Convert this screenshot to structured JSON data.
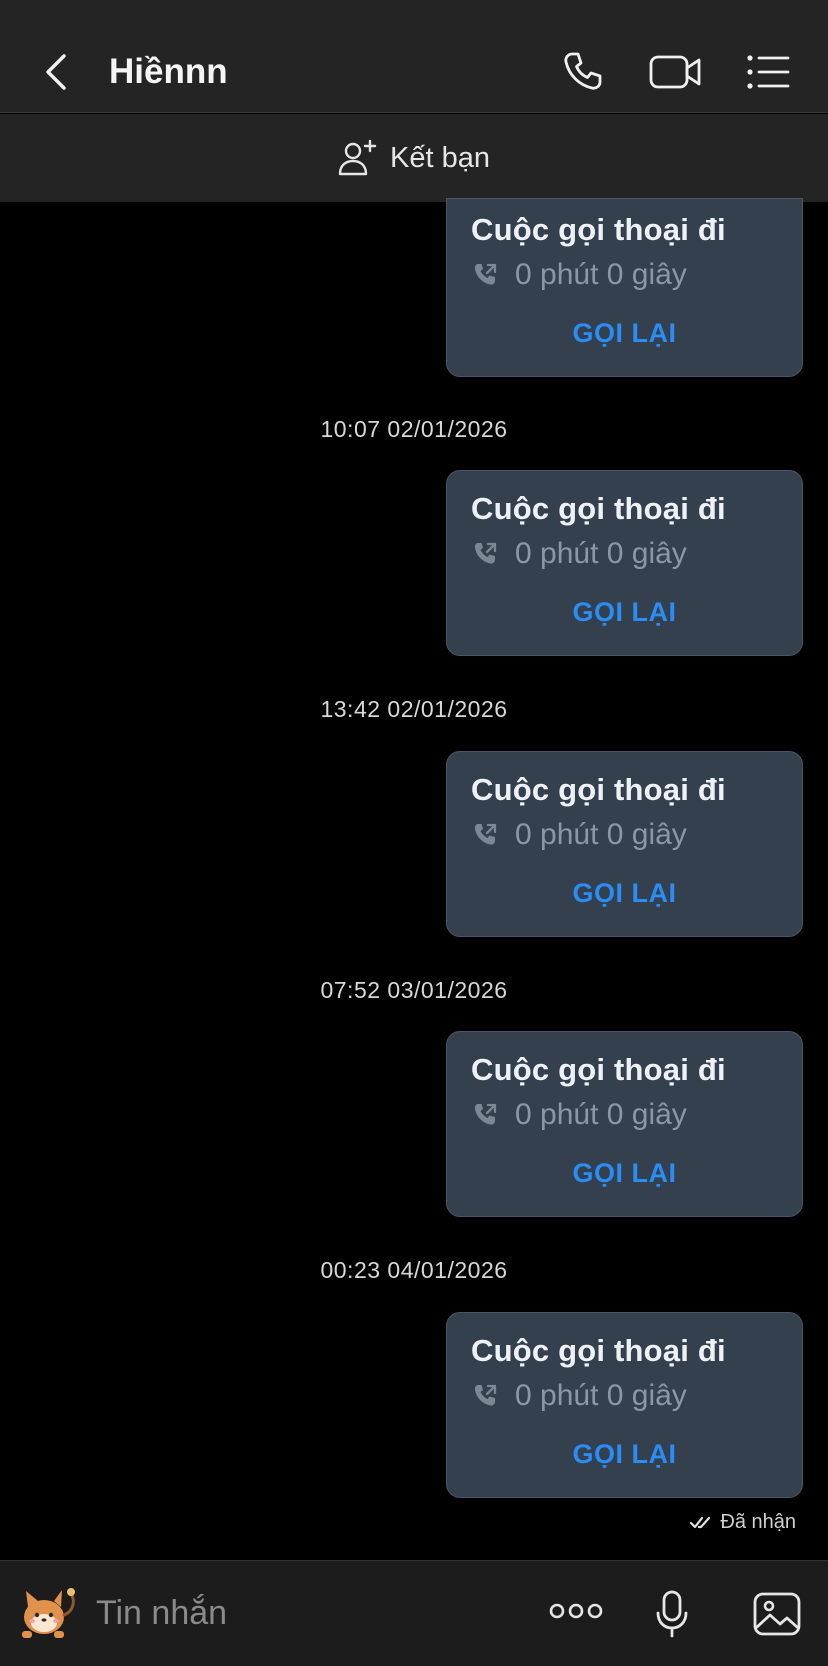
{
  "header": {
    "title": "Hiềnnn",
    "icons": [
      "back-chevron-icon",
      "phone-icon",
      "video-camera-icon",
      "list-menu-icon"
    ]
  },
  "subbar": {
    "add_friend_label": "Kết bạn",
    "icon": "person-plus-icon"
  },
  "messages": [
    {
      "title": "Cuộc gọi thoại đi",
      "duration": "0 phút 0 giây",
      "action": "GỌI LẠI"
    },
    {
      "title": "Cuộc gọi thoại đi",
      "duration": "0 phút 0 giây",
      "action": "GỌI LẠI"
    },
    {
      "title": "Cuộc gọi thoại đi",
      "duration": "0 phút 0 giây",
      "action": "GỌI LẠI"
    },
    {
      "title": "Cuộc gọi thoại đi",
      "duration": "0 phút 0 giây",
      "action": "GỌI LẠI"
    },
    {
      "title": "Cuộc gọi thoại đi",
      "duration": "0 phút 0 giây",
      "action": "GỌI LẠI"
    }
  ],
  "timestamps": [
    "10:07 02/01/2026",
    "13:42 02/01/2026",
    "07:52 03/01/2026",
    "00:23 04/01/2026"
  ],
  "status": {
    "received": "Đã nhận"
  },
  "composer": {
    "placeholder": "Tin nhắn",
    "icons": [
      "sticker-icon",
      "more-options-icon",
      "microphone-icon",
      "image-icon"
    ]
  },
  "colors": {
    "bubble": "#35404e",
    "accent": "#2a8cf5",
    "header": "#242424",
    "background": "#000000"
  }
}
